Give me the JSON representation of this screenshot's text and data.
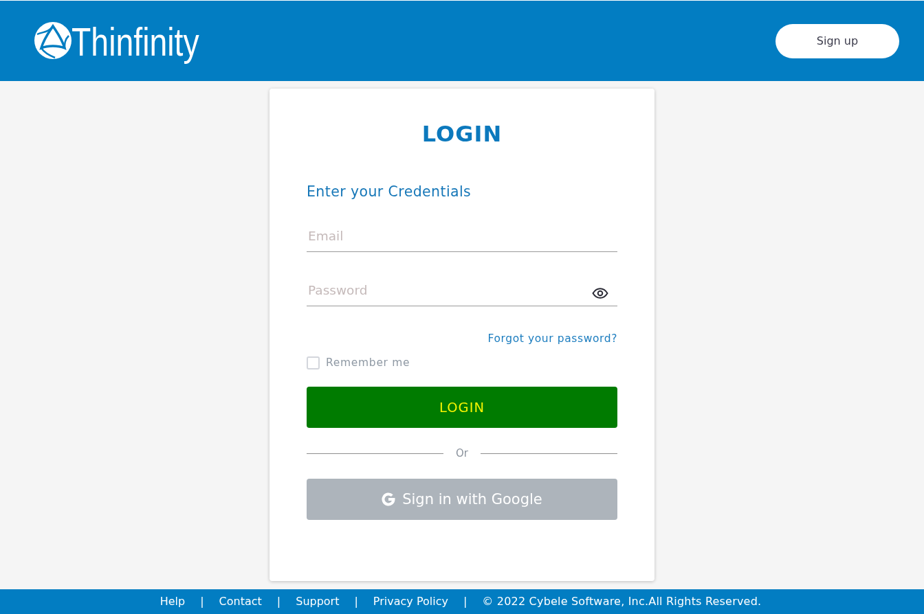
{
  "header": {
    "logo_text": "Thinfinity",
    "signup_button": "Sign up"
  },
  "login_card": {
    "title": "LOGIN",
    "subtitle": "Enter your Credentials",
    "email_field": {
      "placeholder": "Email"
    },
    "password_field": {
      "placeholder": "Password"
    },
    "forgot_link": "Forgot your password?",
    "remember_me": {
      "label": "Remember me",
      "checked": false
    },
    "login_button": "LOGIN",
    "divider_text": "Or",
    "google_button": "Sign in with Google"
  },
  "footer": {
    "links": [
      {
        "label": "Help",
        "separator": "|"
      },
      {
        "label": "Contact",
        "separator": "|"
      },
      {
        "label": "Support",
        "separator": "|"
      },
      {
        "label": "Privacy Policy",
        "separator": "|"
      }
    ],
    "copyright": "© 2022 Cybele Software, Inc.All Rights Reserved."
  }
}
